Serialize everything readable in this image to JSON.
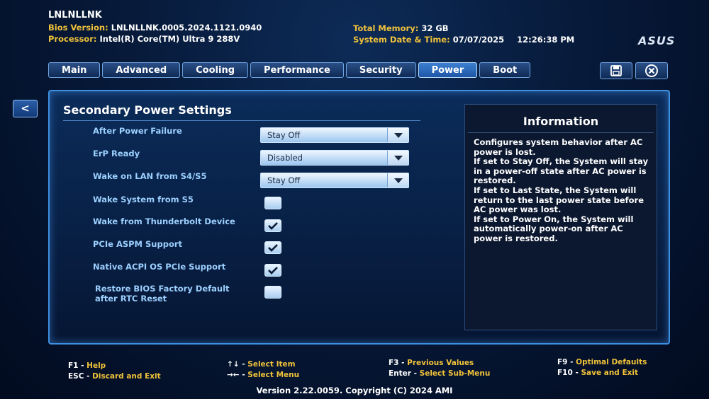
{
  "header": {
    "board": "LNLNLLNK",
    "bios_key": "Bios Version:",
    "bios_val": "LNLNLLNK.0005.2024.1121.0940",
    "proc_key": "Processor:",
    "proc_val": "Intel(R) Core(TM) Ultra 9 288V",
    "mem_key": "Total Memory:",
    "mem_val": "32 GB",
    "dt_key": "System Date & Time:",
    "date": "07/07/2025",
    "time": "12:26:38 PM",
    "logo": "ASUS"
  },
  "tabs": [
    "Main",
    "Advanced",
    "Cooling",
    "Performance",
    "Security",
    "Power",
    "Boot"
  ],
  "active_tab": "Power",
  "back_label": "<",
  "section_title": "Secondary Power Settings",
  "settings": {
    "after_power_failure": {
      "label": "After Power Failure",
      "value": "Stay Off"
    },
    "erp_ready": {
      "label": "ErP Ready",
      "value": "Disabled"
    },
    "wake_on_lan": {
      "label": "Wake on LAN from S4/S5",
      "value": "Stay Off"
    },
    "wake_s5": {
      "label": "Wake System from S5",
      "checked": false
    },
    "wake_tb": {
      "label": "Wake from Thunderbolt Device",
      "checked": true
    },
    "pcie_aspm": {
      "label": "PCIe ASPM Support",
      "checked": true
    },
    "native_acpi": {
      "label": "Native ACPI OS PCIe Support",
      "checked": true
    },
    "restore_line1": "Restore BIOS Factory Default",
    "restore_line2": "after RTC Reset",
    "restore_checked": false
  },
  "info": {
    "title": "Information",
    "text": "Configures system behavior after AC power is lost.\nIf set to Stay Off, the System will stay in a power-off state after AC power is restored.\nIf set to Last State, the System will return to the last power state before AC power was lost.\nIf set to Power On, the System will automatically power-on after AC power is restored."
  },
  "footer": {
    "f1_key": "F1 - ",
    "f1_desc": "Help",
    "esc_key": "ESC - ",
    "esc_desc": "Discard and Exit",
    "arrows_ud_key": "↑↓ - ",
    "arrows_ud_desc": "Select Item",
    "arrows_lr_key": "→← - ",
    "arrows_lr_desc": "Select Menu",
    "f3_key": "F3 - ",
    "f3_desc": "Previous Values",
    "enter_key": "Enter - ",
    "enter_desc": "Select Sub-Menu",
    "f9_key": "F9 - ",
    "f9_desc": "Optimal Defaults",
    "f10_key": "F10 - ",
    "f10_desc": "Save and Exit",
    "version": "Version 2.22.0059. Copyright (C) 2024 AMI"
  },
  "colors": {
    "accent": "#3d8fe0",
    "label": "#9cd0ff",
    "key": "#f0c23a"
  },
  "icons": [
    "save-icon",
    "close-icon",
    "chevron-down-icon",
    "checkmark-icon"
  ]
}
